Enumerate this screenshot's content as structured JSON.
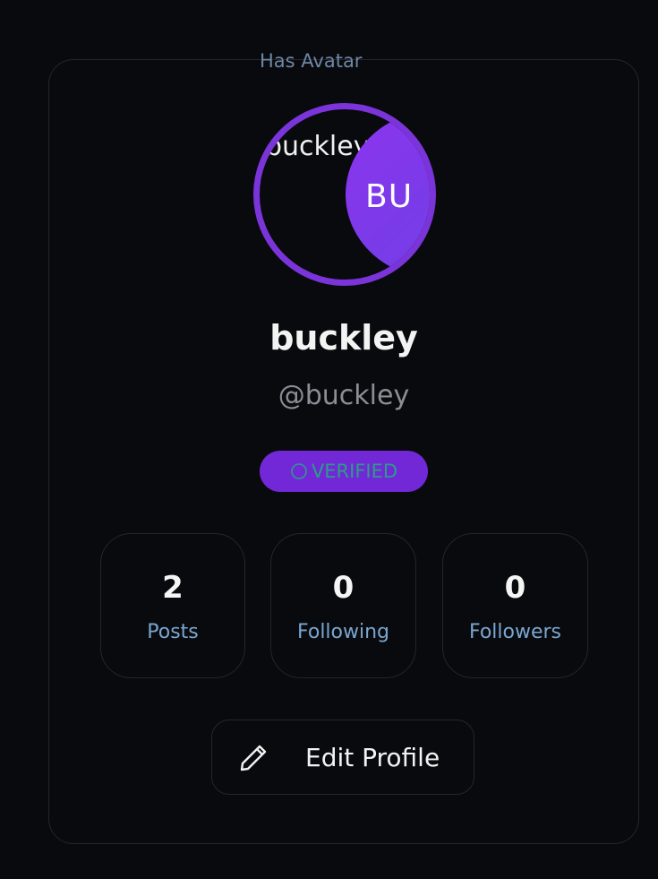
{
  "avatar": {
    "caption": "Has Avatar",
    "alt_text": "buckley",
    "initials": "BU"
  },
  "profile": {
    "display_name": "buckley",
    "handle": "@buckley",
    "badge": "VERIFIED"
  },
  "stats": [
    {
      "value": "2",
      "label": "Posts"
    },
    {
      "value": "0",
      "label": "Following"
    },
    {
      "value": "0",
      "label": "Followers"
    }
  ],
  "actions": {
    "edit_profile": "Edit Profile"
  },
  "icons": {
    "badge": "check-circle-icon",
    "edit": "pencil-icon"
  },
  "colors": {
    "accent": "#7228d7",
    "badge_text": "#2a9d87",
    "stat_label": "#79a6d1"
  }
}
